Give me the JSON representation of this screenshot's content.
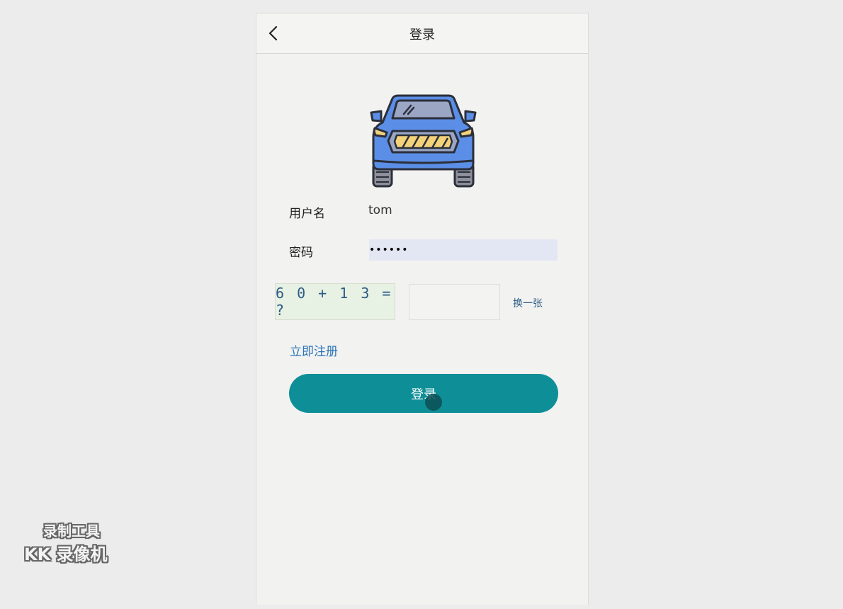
{
  "navbar": {
    "title": "登录",
    "back_icon": "chevron-left-icon"
  },
  "form": {
    "username_label": "用户名",
    "username_value": "tom",
    "password_label": "密码",
    "password_value": "••••••"
  },
  "captcha": {
    "expression": "6 0 + 1 3 = ?",
    "input_value": "",
    "refresh_label": "换一张"
  },
  "register_link": "立即注册",
  "login_button": "登录",
  "watermark": {
    "line1": "录制工具",
    "line2": "KK 录像机"
  },
  "colors": {
    "primary": "#0e8f98",
    "link": "#2a74b8",
    "car_body": "#5b8ee6"
  }
}
